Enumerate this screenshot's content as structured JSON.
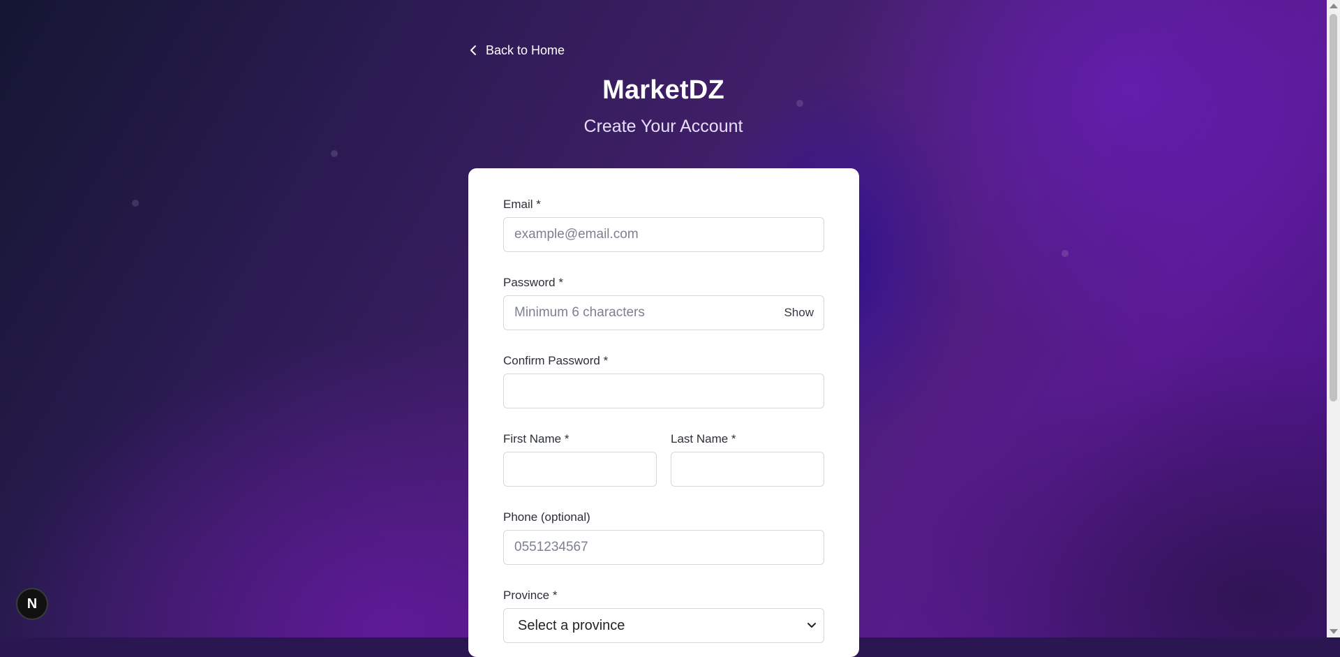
{
  "nav": {
    "back_label": "Back to Home"
  },
  "header": {
    "brand": "MarketDZ",
    "subtitle": "Create Your Account"
  },
  "form": {
    "email": {
      "label": "Email *",
      "placeholder": "example@email.com",
      "value": ""
    },
    "password": {
      "label": "Password *",
      "placeholder": "Minimum 6 characters",
      "value": "",
      "toggle_label": "Show"
    },
    "confirm_password": {
      "label": "Confirm Password *",
      "placeholder": "",
      "value": ""
    },
    "first_name": {
      "label": "First Name *",
      "placeholder": "",
      "value": ""
    },
    "last_name": {
      "label": "Last Name *",
      "placeholder": "",
      "value": ""
    },
    "phone": {
      "label": "Phone (optional)",
      "placeholder": "0551234567",
      "value": ""
    },
    "province": {
      "label": "Province *",
      "selected": "Select a province"
    }
  },
  "dev_badge": {
    "letter": "N"
  },
  "colors": {
    "card": "#ffffff",
    "text": "#2b2f38",
    "border": "#d3d6dc",
    "bg_accent": "#5a1a92"
  }
}
